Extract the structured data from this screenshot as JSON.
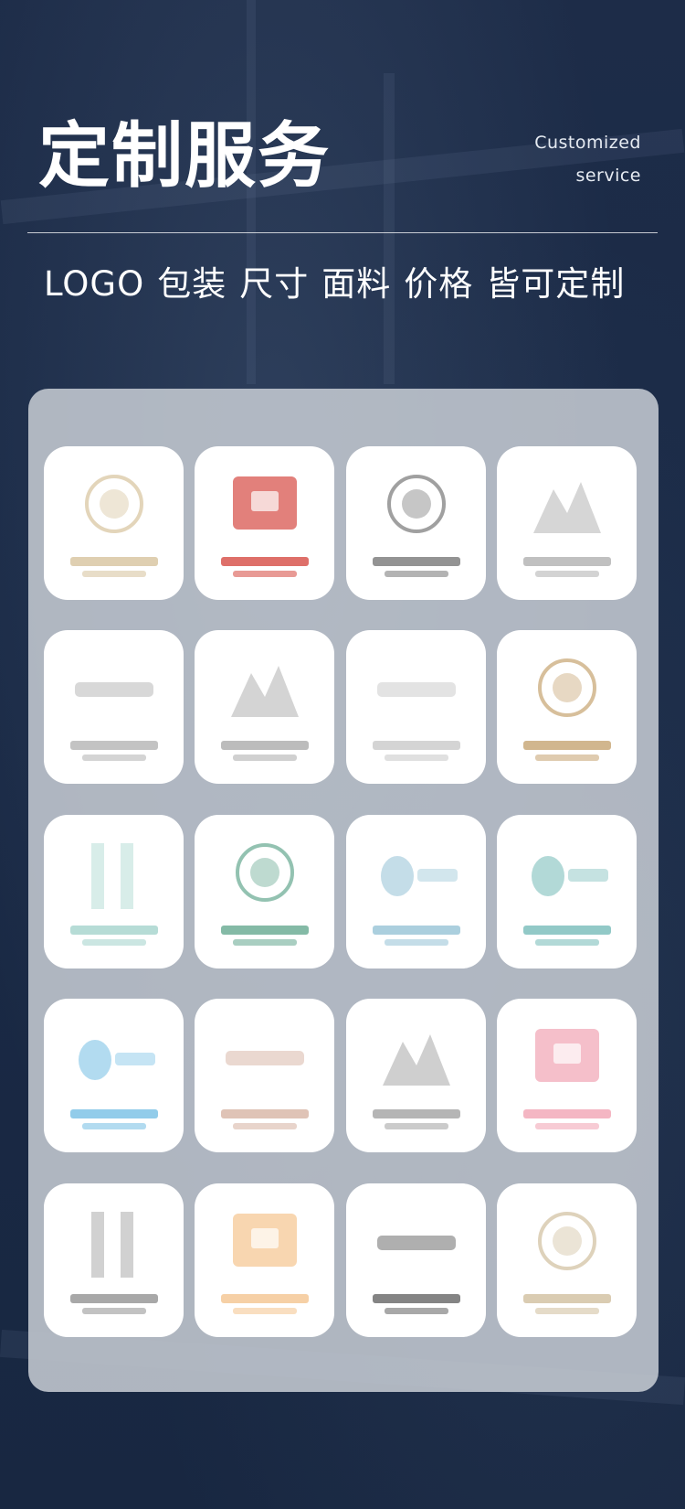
{
  "header": {
    "title": "定制服务",
    "subtitle_line1": "Customized",
    "subtitle_line2": "service"
  },
  "tagline": {
    "items": [
      "LOGO",
      "包装",
      "尺寸",
      "面料",
      "价格",
      "皆可定制"
    ]
  },
  "colors": {
    "background": "#1b2a45",
    "panel": "#c4cad2",
    "tile": "#ffffff"
  },
  "logos": [
    {
      "name": "logo-tile-1",
      "icon": "crest-emblem-icon",
      "color": "#d9c7a3"
    },
    {
      "name": "logo-tile-2",
      "icon": "red-gift-emblem-icon",
      "color": "#d8564f"
    },
    {
      "name": "logo-tile-3",
      "icon": "gray-circle-emblem-icon",
      "color": "#808080"
    },
    {
      "name": "logo-tile-4",
      "icon": "mountain-script-icon",
      "color": "#b5b5b5"
    },
    {
      "name": "logo-tile-5",
      "icon": "courtyard-text-icon",
      "color": "#b8b8b8"
    },
    {
      "name": "logo-tile-6",
      "icon": "mountain-wordmark-icon",
      "color": "#b0b0b0"
    },
    {
      "name": "logo-tile-7",
      "icon": "thin-wordmark-icon",
      "color": "#cccccc"
    },
    {
      "name": "logo-tile-8",
      "icon": "gold-circle-wordmark-icon",
      "color": "#c9a97a"
    },
    {
      "name": "logo-tile-9",
      "icon": "teal-vertical-script-icon",
      "color": "#a9d6cf"
    },
    {
      "name": "logo-tile-10",
      "icon": "green-tree-circle-icon",
      "color": "#6fae97"
    },
    {
      "name": "logo-tile-11",
      "icon": "blue-swirl-wordmark-icon",
      "color": "#9cc7d8"
    },
    {
      "name": "logo-tile-12",
      "icon": "teal-wave-hotel-icon",
      "color": "#7fbfbd"
    },
    {
      "name": "logo-tile-13",
      "icon": "blue-drop-wordmark-icon",
      "color": "#7fc3e6"
    },
    {
      "name": "logo-tile-14",
      "icon": "rose-flower-wordmark-icon",
      "color": "#d9b8a9"
    },
    {
      "name": "logo-tile-15",
      "icon": "building-skyline-icon",
      "color": "#a8a8a8"
    },
    {
      "name": "logo-tile-16",
      "icon": "pink-square-emblem-icon",
      "color": "#f2a9b8"
    },
    {
      "name": "logo-tile-17",
      "icon": "vertical-calligraphy-icon",
      "color": "#999999"
    },
    {
      "name": "logo-tile-18",
      "icon": "orange-banner-emblem-icon",
      "color": "#f5c896"
    },
    {
      "name": "logo-tile-19",
      "icon": "dark-wordmark-icon",
      "color": "#6e6e6e"
    },
    {
      "name": "logo-tile-20",
      "icon": "gold-monogram-circle-icon",
      "color": "#d3c3a4"
    }
  ]
}
